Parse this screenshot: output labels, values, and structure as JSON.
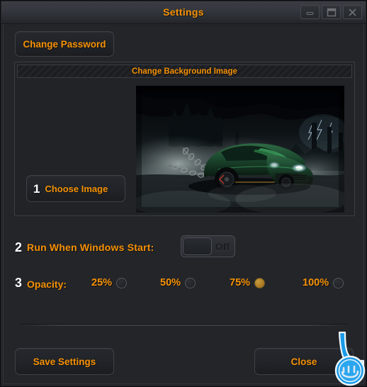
{
  "window": {
    "title": "Settings",
    "accent_color": "#f59105",
    "background_color": "#232529",
    "border_color": "#3b3e45",
    "step_number_color": "#ffffff"
  },
  "titlebar": {
    "title": "Settings",
    "buttons": [
      {
        "name": "minimize",
        "icon": "minimize-icon",
        "tooltip": "Minimize"
      },
      {
        "name": "maximize",
        "icon": "maximize-icon",
        "tooltip": "Maximize"
      },
      {
        "name": "close",
        "icon": "close-icon",
        "tooltip": "Close"
      }
    ]
  },
  "actions": {
    "change_password_label": "Change Password"
  },
  "background_group": {
    "header_label": "Change Background Image",
    "choose_image": {
      "step": "1",
      "label": "Choose Image"
    },
    "preview": {
      "alt": "Dark scene with a green sports car, chains, fog, castle silhouette and lightning"
    }
  },
  "startup": {
    "step": "2",
    "label": "Run When Windows Start:",
    "toggle_state": "Off",
    "toggle_checked": false
  },
  "opacity": {
    "step": "3",
    "label": "Opacity:",
    "selected": "75%",
    "options": [
      {
        "label": "25%",
        "value": 25,
        "checked": false
      },
      {
        "label": "50%",
        "value": 50,
        "checked": false
      },
      {
        "label": "75%",
        "value": 75,
        "checked": true
      },
      {
        "label": "100%",
        "value": 100,
        "checked": false
      }
    ]
  },
  "footer": {
    "save_label": "Save Settings",
    "close_label": "Close"
  },
  "overlay": {
    "cursor_icon": "custom-arrow-cursor-icon",
    "cursor_color": "#1a9ae8"
  }
}
